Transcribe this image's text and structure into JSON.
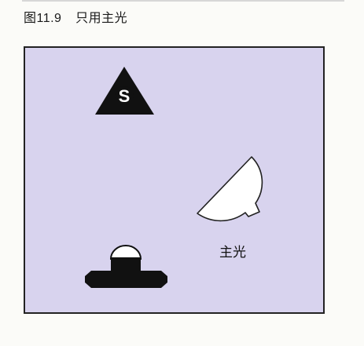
{
  "figure": {
    "caption_number": "图11.9",
    "caption_title": "只用主光"
  },
  "diagram": {
    "subject_label": "S",
    "key_light_label": "主光",
    "colors": {
      "stage_fill": "#d8d3ee",
      "stage_border": "#222222",
      "subject_fill": "#111111",
      "light_fill": "#ffffff",
      "camera_fill": "#111111"
    }
  }
}
